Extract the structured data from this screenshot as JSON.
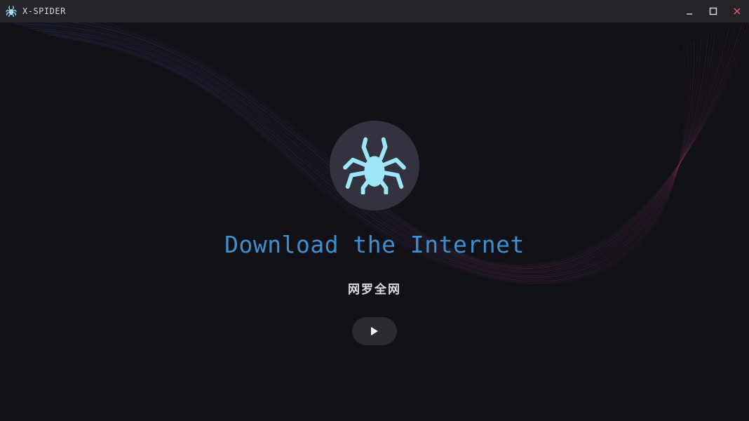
{
  "window": {
    "title": "X-SPIDER",
    "app_icon": "spider-icon",
    "controls": {
      "minimize_icon": "minimize-icon",
      "maximize_icon": "maximize-icon",
      "close_icon": "close-icon"
    }
  },
  "main": {
    "logo_icon": "spider-icon",
    "headline": "Download the Internet",
    "subtitle": "网罗全网",
    "play_icon": "play-icon"
  },
  "colors": {
    "background": "#121118",
    "titlebar": "#232329",
    "logo_circle": "#33333f",
    "spider": "#9ee6f7",
    "headline": "#3f8fcf",
    "subtitle": "#dcdce2",
    "close_accent": "#e05a5a",
    "wave_blue": "#4a64b4",
    "wave_pink": "#b43c6e"
  }
}
